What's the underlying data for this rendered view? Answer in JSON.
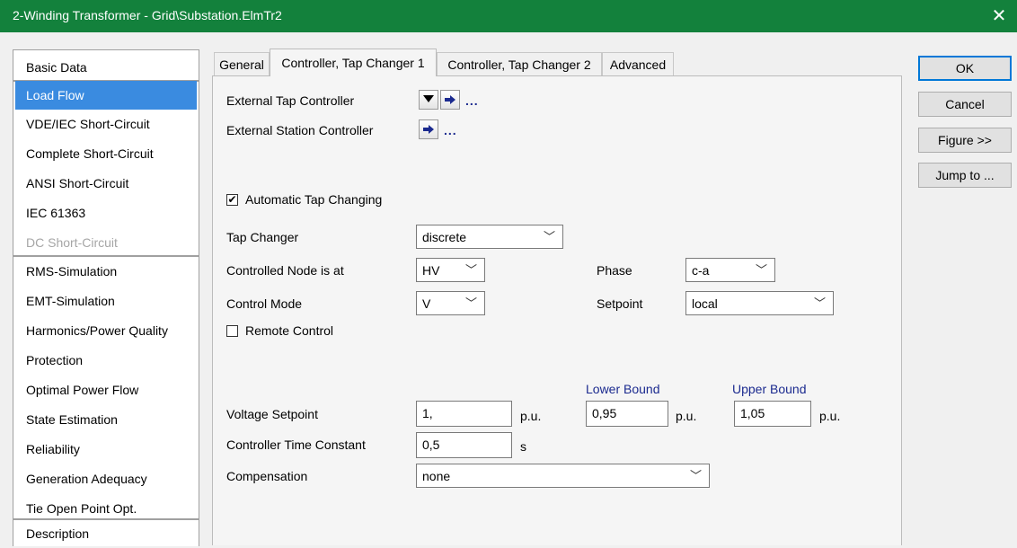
{
  "window": {
    "title": "2-Winding Transformer - Grid\\Substation.ElmTr2",
    "close_glyph": "✕"
  },
  "sidebar": {
    "items": [
      {
        "label": "Basic Data"
      },
      {
        "label": "Load Flow"
      },
      {
        "label": "VDE/IEC Short-Circuit"
      },
      {
        "label": "Complete Short-Circuit"
      },
      {
        "label": "ANSI Short-Circuit"
      },
      {
        "label": "IEC 61363"
      },
      {
        "label": "DC Short-Circuit"
      },
      {
        "label": "RMS-Simulation"
      },
      {
        "label": "EMT-Simulation"
      },
      {
        "label": "Harmonics/Power Quality"
      },
      {
        "label": "Protection"
      },
      {
        "label": "Optimal Power Flow"
      },
      {
        "label": "State Estimation"
      },
      {
        "label": "Reliability"
      },
      {
        "label": "Generation Adequacy"
      },
      {
        "label": "Tie Open Point Opt."
      },
      {
        "label": "Description"
      }
    ],
    "selected": "Load Flow",
    "disabled": [
      "DC Short-Circuit"
    ]
  },
  "tabs": [
    {
      "label": "General"
    },
    {
      "label": "Controller, Tap Changer 1"
    },
    {
      "label": "Controller, Tap Changer 2"
    },
    {
      "label": "Advanced"
    }
  ],
  "form": {
    "external_tap_controller": {
      "label": "External Tap Controller",
      "dots": "..."
    },
    "external_station_controller": {
      "label": "External Station Controller",
      "dots": "..."
    },
    "automatic_tap_changing": {
      "label": "Automatic Tap Changing",
      "checked": true
    },
    "tap_changer": {
      "label": "Tap Changer",
      "value": "discrete"
    },
    "controlled_node": {
      "label": "Controlled Node is at",
      "value": "HV"
    },
    "phase": {
      "label": "Phase",
      "value": "c-a"
    },
    "control_mode": {
      "label": "Control Mode",
      "value": "V"
    },
    "setpoint": {
      "label": "Setpoint",
      "value": "local"
    },
    "remote_control": {
      "label": "Remote Control",
      "checked": false
    },
    "lower_bound_header": "Lower Bound",
    "upper_bound_header": "Upper Bound",
    "voltage_setpoint": {
      "label": "Voltage Setpoint",
      "value": "1,",
      "unit": "p.u.",
      "lower": "0,95",
      "lower_unit": "p.u.",
      "upper": "1,05",
      "upper_unit": "p.u."
    },
    "controller_time_constant": {
      "label": "Controller Time Constant",
      "value": "0,5",
      "unit": "s"
    },
    "compensation": {
      "label": "Compensation",
      "value": "none"
    }
  },
  "buttons": {
    "ok": "OK",
    "cancel": "Cancel",
    "figure": "Figure >>",
    "jump": "Jump to ..."
  },
  "colors": {
    "titlebar": "#13813c",
    "selection": "#3a8be0",
    "link": "#1b2a8f"
  }
}
